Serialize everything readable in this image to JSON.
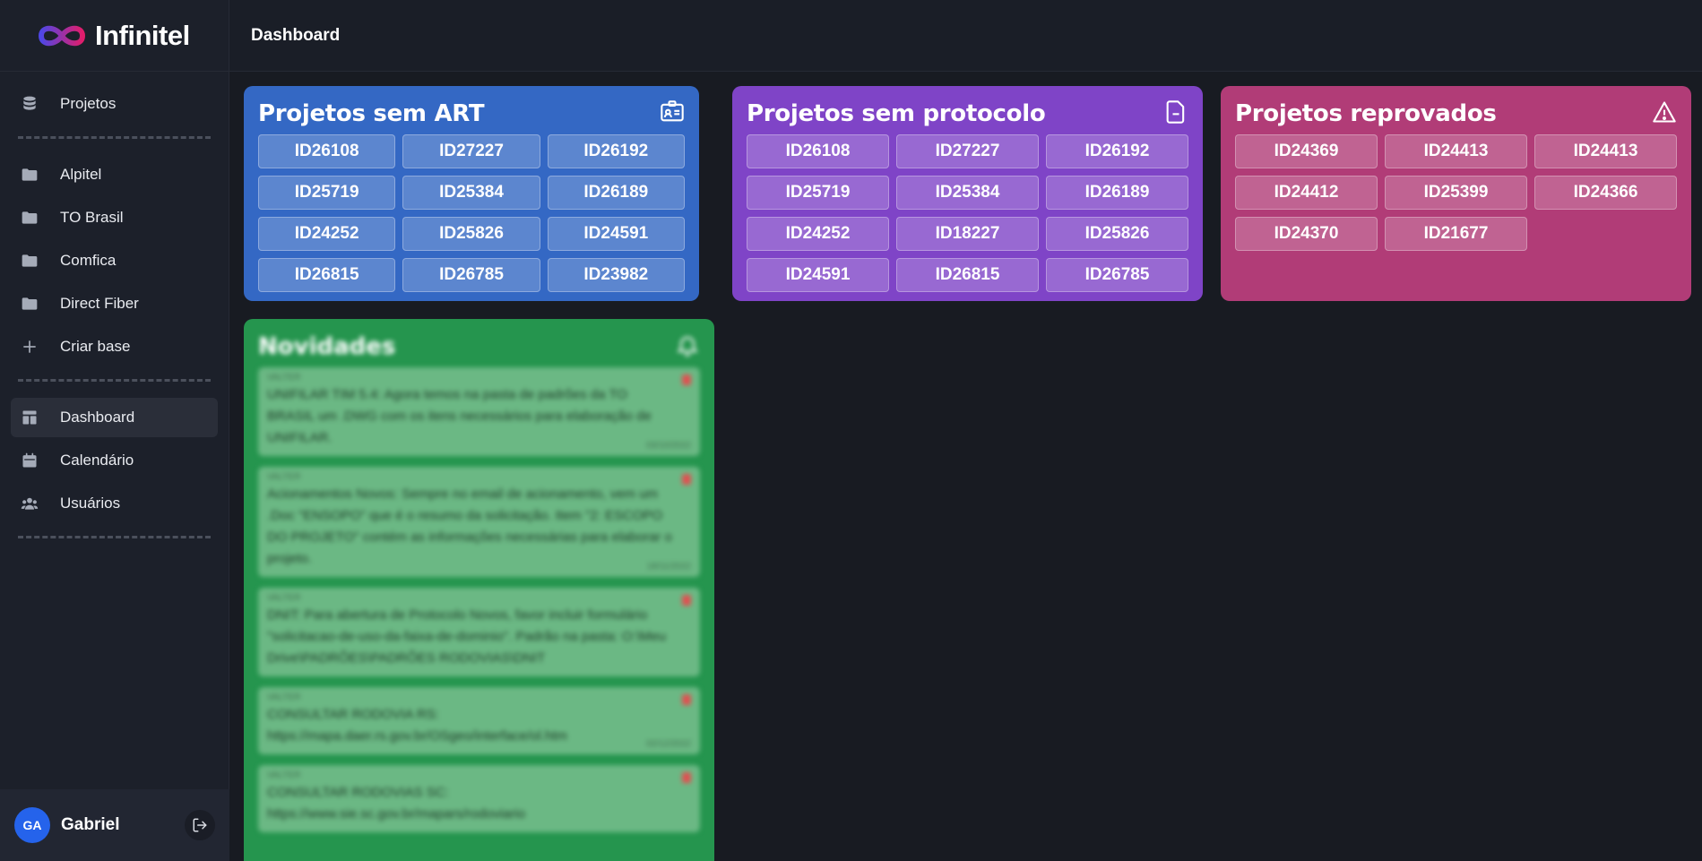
{
  "brand": {
    "name": "Infinitel"
  },
  "header": {
    "title": "Dashboard"
  },
  "sidebar": {
    "group1": [
      {
        "label": "Projetos",
        "icon": "database-icon"
      }
    ],
    "group2": [
      {
        "label": "Alpitel",
        "icon": "folder-icon"
      },
      {
        "label": "TO Brasil",
        "icon": "folder-icon"
      },
      {
        "label": "Comfica",
        "icon": "folder-icon"
      },
      {
        "label": "Direct Fiber",
        "icon": "folder-icon"
      },
      {
        "label": "Criar base",
        "icon": "plus-icon"
      }
    ],
    "group3": [
      {
        "label": "Dashboard",
        "icon": "layout-icon",
        "active": true
      },
      {
        "label": "Calendário",
        "icon": "calendar-icon"
      },
      {
        "label": "Usuários",
        "icon": "users-icon"
      }
    ]
  },
  "user": {
    "initials": "GA",
    "name": "Gabriel"
  },
  "cards": {
    "art": {
      "title": "Projetos sem ART",
      "icon": "id-card-icon",
      "color": "#3468c4",
      "ids": [
        "ID26108",
        "ID27227",
        "ID26192",
        "ID25719",
        "ID25384",
        "ID26189",
        "ID24252",
        "ID25826",
        "ID24591",
        "ID26815",
        "ID26785",
        "ID23982"
      ]
    },
    "protocolo": {
      "title": "Projetos sem protocolo",
      "icon": "document-icon",
      "color": "#7f44c7",
      "ids": [
        "ID26108",
        "ID27227",
        "ID26192",
        "ID25719",
        "ID25384",
        "ID26189",
        "ID24252",
        "ID18227",
        "ID25826",
        "ID24591",
        "ID26815",
        "ID26785"
      ]
    },
    "reprovados": {
      "title": "Projetos reprovados",
      "icon": "warning-icon",
      "color": "#b13c77",
      "ids": [
        "ID24369",
        "ID24413",
        "ID24413",
        "ID24412",
        "ID25399",
        "ID24366",
        "ID24370",
        "ID21677"
      ]
    }
  },
  "news": {
    "title": "Novidades",
    "icon": "bell-icon",
    "color": "#25954e",
    "items": [
      {
        "author": "VALTER",
        "text": "UNIFILAR TIM 5.4: Agora temos na pasta de padrões da TO BRASIL um .DWG com os itens necessários para elaboração de UNIFILAR.",
        "date": "03/10/2022"
      },
      {
        "author": "VALTER",
        "text": "Acionamentos Novos: Sempre no email de acionamento, vem um .Doc \"ENSOPO\" que é o resumo da solicitação. Item \"2: ESCOPO DO PROJETO\" contém as informações necessárias para elaborar o projeto.",
        "date": "18/11/2022"
      },
      {
        "author": "VALTER",
        "text": "DNIT: Para abertura de Protocolo Novos, favor incluir formulário \"solicitacao-de-uso-da-faixa-de-dominio\". Padrão na pasta: O:\\Meu Drive\\PADRÕES\\PADRÕES RODOVIAS\\DNIT",
        "date": ""
      },
      {
        "author": "VALTER",
        "text": "CONSULTAR RODOVIA RS: https://mapa.daer.rs.gov.br/OSgeo/interface/ol.htm",
        "date": "02/12/2022"
      },
      {
        "author": "VALTER",
        "text": "CONSULTAR RODOVIAS SC: https://www.sie.sc.gov.br/mapars/rodoviario",
        "date": ""
      }
    ]
  }
}
